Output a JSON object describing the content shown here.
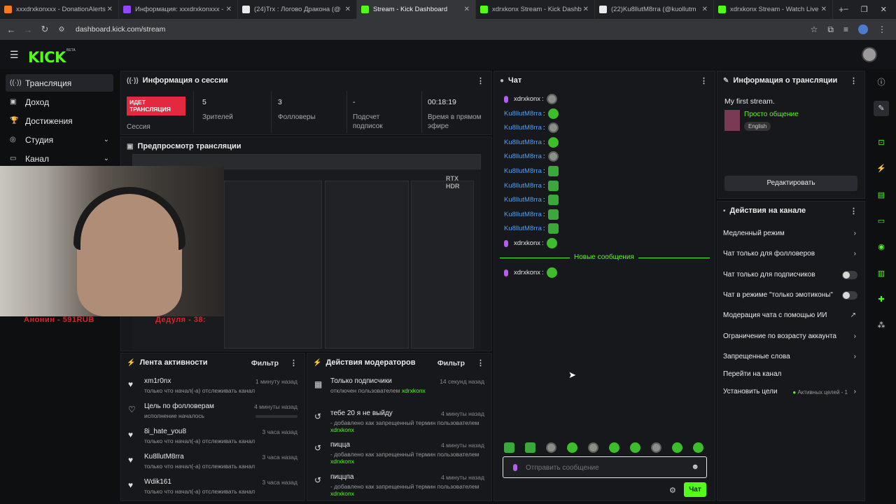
{
  "browser": {
    "tabs": [
      {
        "label": "xxxdrxkonxxx - DonationAlerts",
        "color": "#f37c22",
        "active": false
      },
      {
        "label": "Информация: xxxdrxkonxxx - ",
        "color": "#9146ff",
        "active": false
      },
      {
        "label": "(24)Trx : Логово Дракона (@",
        "color": "#000000",
        "active": false
      },
      {
        "label": "Stream - Kick Dashboard",
        "color": "#53fc18",
        "active": true
      },
      {
        "label": "xdrxkonx Stream - Kick Dashb",
        "color": "#53fc18",
        "active": false
      },
      {
        "label": "(22)Ku8llutM8rra (@kuollutm",
        "color": "#000000",
        "active": false
      },
      {
        "label": "xdrxkonx Stream - Watch Live",
        "color": "#53fc18",
        "active": false
      }
    ],
    "url": "dashboard.kick.com/stream"
  },
  "header": {
    "logo": "KICK",
    "beta": "BETA"
  },
  "sidebar": {
    "items": [
      {
        "label": "Трансляция",
        "icon": "broadcast-icon"
      },
      {
        "label": "Доход",
        "icon": "wallet-icon"
      },
      {
        "label": "Достижения",
        "icon": "trophy-icon"
      },
      {
        "label": "Студия",
        "icon": "studio-icon"
      },
      {
        "label": "Канал",
        "icon": "channel-icon"
      }
    ]
  },
  "session": {
    "title": "Информация о сессии",
    "live_badge": "ИДЕТ ТРАНСЛЯЦИЯ",
    "live_label": "Сессия",
    "stats": [
      {
        "value": "5",
        "label": "Зрителей"
      },
      {
        "value": "3",
        "label": "Фолловеры"
      },
      {
        "value": "-",
        "label": "Подсчет подписок"
      },
      {
        "value": "00:18:19",
        "label": "Время в прямом эфире"
      }
    ]
  },
  "preview": {
    "title": "Предпросмотр трансляции",
    "overlay_left": "Анонин - 591RUB",
    "overlay_right": "Дедуля - 38:"
  },
  "activity": {
    "title": "Лента активности",
    "filter": "Фильтр",
    "items": [
      {
        "name": "xm1r0nx",
        "desc": "только что начал(-а) отслеживать канал",
        "time": "1 минуту назад",
        "icon": "heart-icon"
      },
      {
        "name": "Цель по фолловерам",
        "desc": "исполнение началось",
        "time": "4 минуты назад",
        "icon": "heart-outline-icon"
      },
      {
        "name": "8i_hate_you8",
        "desc": "только что начал(-а) отслеживать канал",
        "time": "3 часа назад",
        "icon": "heart-icon"
      },
      {
        "name": "Ku8llutM8rra",
        "desc": "только что начал(-а) отслеживать канал",
        "time": "3 часа назад",
        "icon": "heart-icon"
      },
      {
        "name": "Wdik161",
        "desc": "только что начал(-а) отслеживать канал",
        "time": "3 часа назад",
        "icon": "heart-icon"
      }
    ],
    "goal_progress": 0
  },
  "modactions": {
    "title": "Действия модераторов",
    "filter": "Фильтр",
    "items": [
      {
        "name": "Только подписчики",
        "desc": "отключен пользователем",
        "user": "xdrxkonx",
        "time": "14 секунд назад",
        "icon": "gift-icon"
      },
      {
        "name": "тебе 20 я не выйду",
        "desc": "- добавлено как запрещенный термин пользователем",
        "user": "xdrxkonx",
        "time": "4 минуты назад",
        "icon": "history-icon"
      },
      {
        "name": "пицца",
        "desc": "- добавлено как запрещенный термин пользователем",
        "user": "xdrxkonx",
        "time": "4 минуты назад",
        "icon": "history-icon"
      },
      {
        "name": "пиццпа",
        "desc": "- добавлено как запрещенный термин пользователем",
        "user": "xdrxkonx",
        "time": "4 минуты назад",
        "icon": "history-icon"
      }
    ]
  },
  "chat": {
    "title": "Чат",
    "messages": [
      {
        "user": "xdrxkonx",
        "color": "#e6e6e6",
        "mic": true,
        "emote": "h"
      },
      {
        "user": "Ku8llutM8rra",
        "color": "#4aa3ff",
        "mic": false,
        "emote": "g"
      },
      {
        "user": "Ku8llutM8rra",
        "color": "#4aa3ff",
        "mic": false,
        "emote": "h"
      },
      {
        "user": "Ku8llutM8rra",
        "color": "#4aa3ff",
        "mic": false,
        "emote": "g"
      },
      {
        "user": "Ku8llutM8rra",
        "color": "#4aa3ff",
        "mic": false,
        "emote": "h"
      },
      {
        "user": "Ku8llutM8rra",
        "color": "#4aa3ff",
        "mic": false,
        "emote": "s"
      },
      {
        "user": "Ku8llutM8rra",
        "color": "#4aa3ff",
        "mic": false,
        "emote": "s"
      },
      {
        "user": "Ku8llutM8rra",
        "color": "#4aa3ff",
        "mic": false,
        "emote": "s"
      },
      {
        "user": "Ku8llutM8rra",
        "color": "#4aa3ff",
        "mic": false,
        "emote": "s"
      },
      {
        "user": "Ku8llutM8rra",
        "color": "#4aa3ff",
        "mic": false,
        "emote": "s"
      },
      {
        "user": "xdrxkonx",
        "color": "#e6e6e6",
        "mic": true,
        "emote": "g"
      }
    ],
    "new_messages": "Новые сообщения",
    "after": [
      {
        "user": "xdrxkonx",
        "color": "#e6e6e6",
        "mic": true,
        "emote": "g"
      }
    ],
    "input_placeholder": "Отправить сообщение",
    "send_label": "Чат"
  },
  "stream_info": {
    "title": "Информация о трансляции",
    "stream_title": "My first stream.",
    "category": "Просто общение",
    "language": "English",
    "edit_label": "Редактировать"
  },
  "channel_actions": {
    "title": "Действия на канале",
    "items": [
      {
        "label": "Медленный режим",
        "control": "arrow"
      },
      {
        "label": "Чат только для фолловеров",
        "control": "arrow"
      },
      {
        "label": "Чат только для подписчиков",
        "control": "toggle"
      },
      {
        "label": "Чат в режиме \"только эмотиконы\"",
        "control": "toggle"
      },
      {
        "label": "Модерация чата с помощью ИИ",
        "control": "external"
      },
      {
        "label": "Ограничение по возрасту аккаунта",
        "control": "arrow"
      },
      {
        "label": "Запрещенные слова",
        "control": "arrow"
      },
      {
        "label": "Перейти на канал",
        "control": "none"
      },
      {
        "label": "Установить цели",
        "control": "arrow"
      }
    ],
    "goals_badge": "Активных целей - 1"
  },
  "colors": {
    "accent": "#53fc18",
    "live": "#e2293f"
  }
}
